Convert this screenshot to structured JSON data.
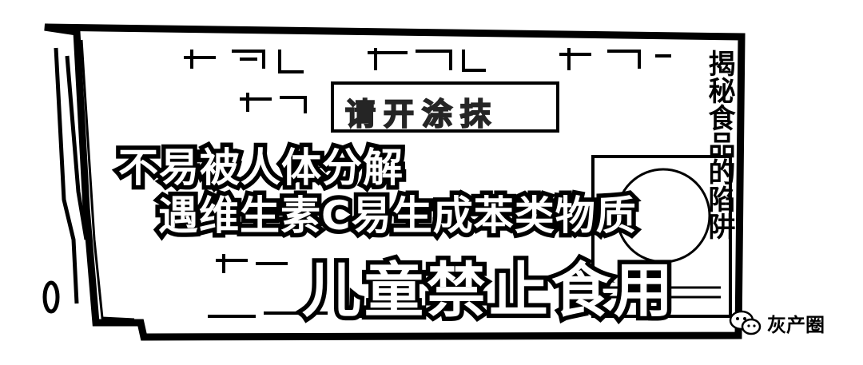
{
  "captions": {
    "line1": "不易被人体分解",
    "line2": "遇维生素C易生成苯类物质",
    "line3": "儿童禁止食用"
  },
  "label": {
    "stamp": "请开涂抹"
  },
  "side_text": "揭秘食品的陷阱",
  "watermark": {
    "icon": "wechat-icon",
    "text": "灰产圈"
  }
}
